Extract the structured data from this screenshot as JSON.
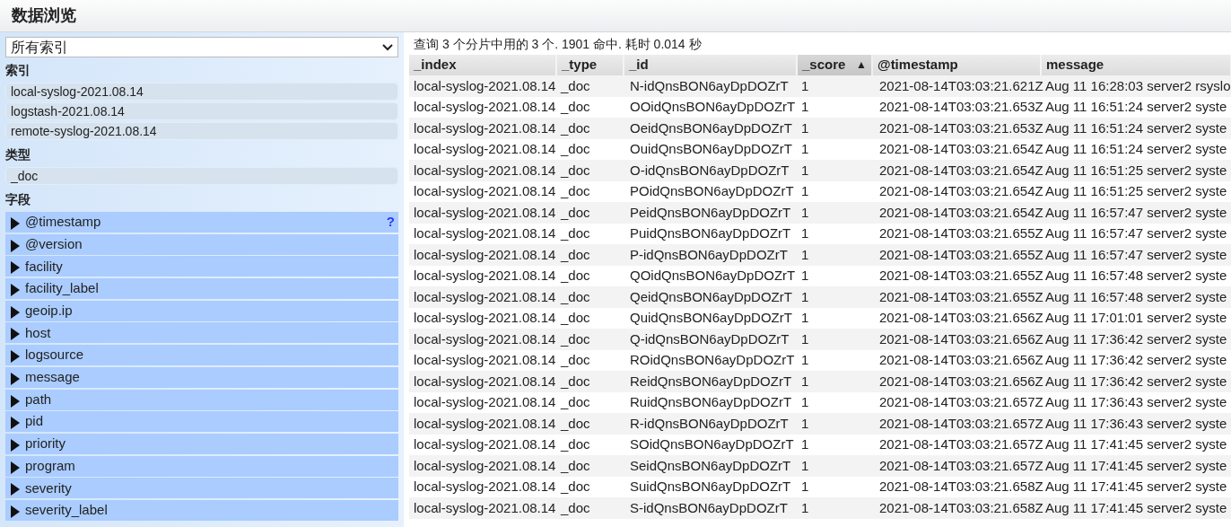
{
  "header": {
    "title": "数据浏览"
  },
  "sidebar": {
    "index_select": {
      "value": "所有索引"
    },
    "sections": [
      {
        "kind": "list",
        "heading": "索引",
        "items": [
          "local-syslog-2021.08.14",
          "logstash-2021.08.14",
          "remote-syslog-2021.08.14"
        ]
      },
      {
        "kind": "list",
        "heading": "类型",
        "items": [
          "_doc"
        ]
      },
      {
        "kind": "fields",
        "heading": "字段",
        "items": [
          {
            "label": "@timestamp",
            "help": "?"
          },
          {
            "label": "@version"
          },
          {
            "label": "facility"
          },
          {
            "label": "facility_label"
          },
          {
            "label": "geoip.ip"
          },
          {
            "label": "host"
          },
          {
            "label": "logsource"
          },
          {
            "label": "message"
          },
          {
            "label": "path"
          },
          {
            "label": "pid"
          },
          {
            "label": "priority"
          },
          {
            "label": "program"
          },
          {
            "label": "severity"
          },
          {
            "label": "severity_label"
          }
        ]
      }
    ]
  },
  "results": {
    "summary": "查询 3 个分片中用的 3 个. 1901 命中. 耗时 0.014 秒",
    "table": {
      "columns": [
        {
          "label": "_index",
          "sorted": false
        },
        {
          "label": "_type",
          "sorted": false
        },
        {
          "label": "_id",
          "sorted": false
        },
        {
          "label": "_score",
          "sorted": true,
          "sort_indicator": "▲"
        },
        {
          "label": "@timestamp",
          "sorted": false
        },
        {
          "label": "message",
          "sorted": false
        }
      ],
      "rows": [
        [
          "local-syslog-2021.08.14",
          "_doc",
          "N-idQnsBON6ayDpDOZrT",
          "1",
          "2021-08-14T03:03:21.621Z",
          "Aug 11 16:28:03 server2 rsyslo"
        ],
        [
          "local-syslog-2021.08.14",
          "_doc",
          "OOidQnsBON6ayDpDOZrT",
          "1",
          "2021-08-14T03:03:21.653Z",
          "Aug 11 16:51:24 server2 syste"
        ],
        [
          "local-syslog-2021.08.14",
          "_doc",
          "OeidQnsBON6ayDpDOZrT",
          "1",
          "2021-08-14T03:03:21.653Z",
          "Aug 11 16:51:24 server2 syste"
        ],
        [
          "local-syslog-2021.08.14",
          "_doc",
          "OuidQnsBON6ayDpDOZrT",
          "1",
          "2021-08-14T03:03:21.654Z",
          "Aug 11 16:51:24 server2 syste"
        ],
        [
          "local-syslog-2021.08.14",
          "_doc",
          "O-idQnsBON6ayDpDOZrT",
          "1",
          "2021-08-14T03:03:21.654Z",
          "Aug 11 16:51:25 server2 syste"
        ],
        [
          "local-syslog-2021.08.14",
          "_doc",
          "POidQnsBON6ayDpDOZrT",
          "1",
          "2021-08-14T03:03:21.654Z",
          "Aug 11 16:51:25 server2 syste"
        ],
        [
          "local-syslog-2021.08.14",
          "_doc",
          "PeidQnsBON6ayDpDOZrT",
          "1",
          "2021-08-14T03:03:21.654Z",
          "Aug 11 16:57:47 server2 syste"
        ],
        [
          "local-syslog-2021.08.14",
          "_doc",
          "PuidQnsBON6ayDpDOZrT",
          "1",
          "2021-08-14T03:03:21.655Z",
          "Aug 11 16:57:47 server2 syste"
        ],
        [
          "local-syslog-2021.08.14",
          "_doc",
          "P-idQnsBON6ayDpDOZrT",
          "1",
          "2021-08-14T03:03:21.655Z",
          "Aug 11 16:57:47 server2 syste"
        ],
        [
          "local-syslog-2021.08.14",
          "_doc",
          "QOidQnsBON6ayDpDOZrT",
          "1",
          "2021-08-14T03:03:21.655Z",
          "Aug 11 16:57:48 server2 syste"
        ],
        [
          "local-syslog-2021.08.14",
          "_doc",
          "QeidQnsBON6ayDpDOZrT",
          "1",
          "2021-08-14T03:03:21.655Z",
          "Aug 11 16:57:48 server2 syste"
        ],
        [
          "local-syslog-2021.08.14",
          "_doc",
          "QuidQnsBON6ayDpDOZrT",
          "1",
          "2021-08-14T03:03:21.656Z",
          "Aug 11 17:01:01 server2 syste"
        ],
        [
          "local-syslog-2021.08.14",
          "_doc",
          "Q-idQnsBON6ayDpDOZrT",
          "1",
          "2021-08-14T03:03:21.656Z",
          "Aug 11 17:36:42 server2 syste"
        ],
        [
          "local-syslog-2021.08.14",
          "_doc",
          "ROidQnsBON6ayDpDOZrT",
          "1",
          "2021-08-14T03:03:21.656Z",
          "Aug 11 17:36:42 server2 syste"
        ],
        [
          "local-syslog-2021.08.14",
          "_doc",
          "ReidQnsBON6ayDpDOZrT",
          "1",
          "2021-08-14T03:03:21.656Z",
          "Aug 11 17:36:42 server2 syste"
        ],
        [
          "local-syslog-2021.08.14",
          "_doc",
          "RuidQnsBON6ayDpDOZrT",
          "1",
          "2021-08-14T03:03:21.657Z",
          "Aug 11 17:36:43 server2 syste"
        ],
        [
          "local-syslog-2021.08.14",
          "_doc",
          "R-idQnsBON6ayDpDOZrT",
          "1",
          "2021-08-14T03:03:21.657Z",
          "Aug 11 17:36:43 server2 syste"
        ],
        [
          "local-syslog-2021.08.14",
          "_doc",
          "SOidQnsBON6ayDpDOZrT",
          "1",
          "2021-08-14T03:03:21.657Z",
          "Aug 11 17:41:45 server2 syste"
        ],
        [
          "local-syslog-2021.08.14",
          "_doc",
          "SeidQnsBON6ayDpDOZrT",
          "1",
          "2021-08-14T03:03:21.657Z",
          "Aug 11 17:41:45 server2 syste"
        ],
        [
          "local-syslog-2021.08.14",
          "_doc",
          "SuidQnsBON6ayDpDOZrT",
          "1",
          "2021-08-14T03:03:21.658Z",
          "Aug 11 17:41:45 server2 syste"
        ],
        [
          "local-syslog-2021.08.14",
          "_doc",
          "S-idQnsBON6ayDpDOZrT",
          "1",
          "2021-08-14T03:03:21.658Z",
          "Aug 11 17:41:45 server2 syste"
        ]
      ]
    }
  }
}
